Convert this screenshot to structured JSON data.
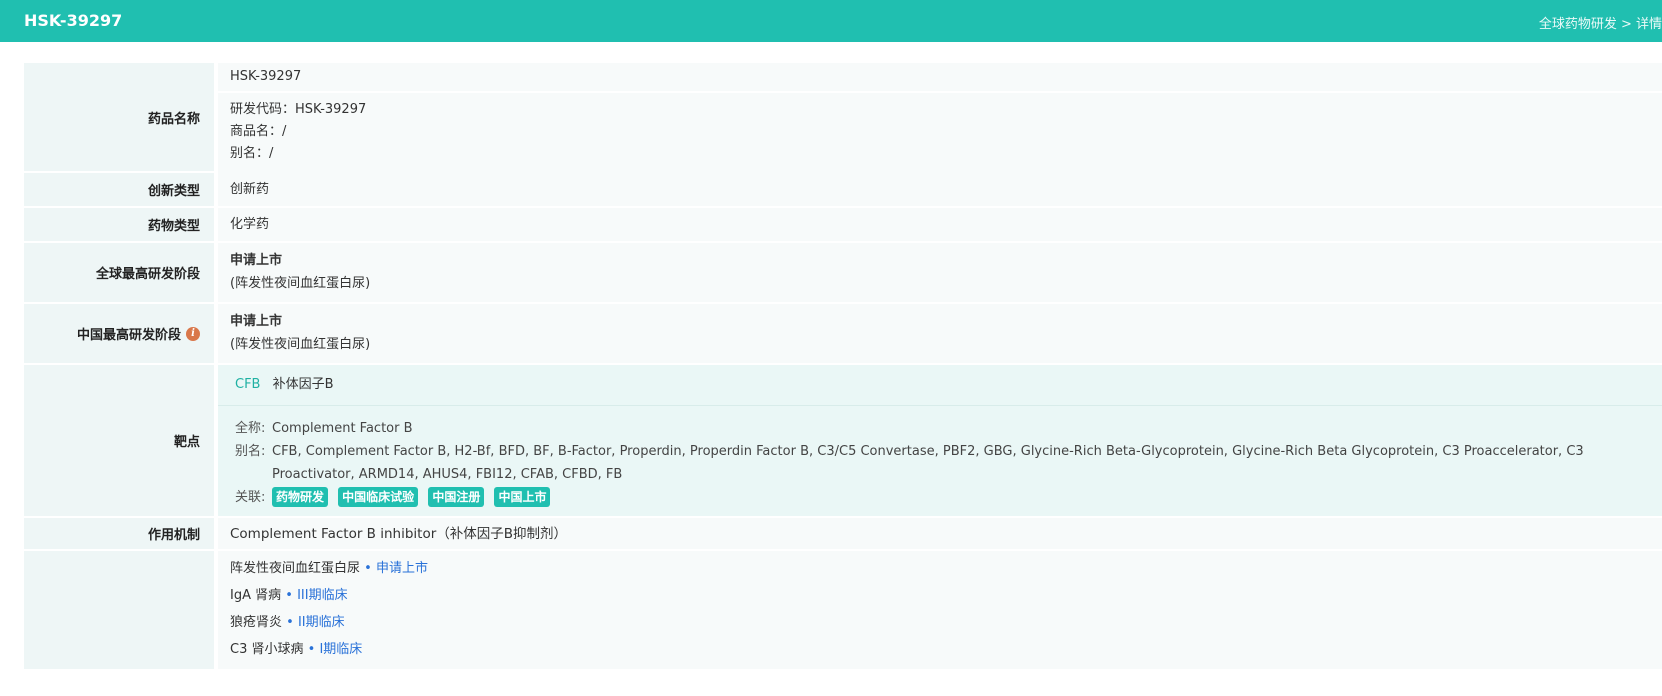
{
  "header": {
    "title": "HSK-39297",
    "breadcrumb": "全球药物研发 > 详情"
  },
  "drug_name": {
    "label": "药品名称",
    "name": "HSK-39297",
    "code": "研发代码：HSK-39297",
    "trade_name": "商品名：/",
    "alias": "别名：/"
  },
  "innovation": {
    "label": "创新类型",
    "value": "创新药"
  },
  "drug_type": {
    "label": "药物类型",
    "value": "化学药"
  },
  "global_stage": {
    "label": "全球最高研发阶段",
    "stage": "申请上市",
    "indication": "(阵发性夜间血红蛋白尿)"
  },
  "china_stage": {
    "label": "中国最高研发阶段",
    "icon": "info-icon",
    "stage": "申请上市",
    "indication": "(阵发性夜间血红蛋白尿)"
  },
  "target": {
    "label": "靶点",
    "code": "CFB",
    "name": "补体因子B",
    "fullname_key": "全称:",
    "fullname": "Complement Factor B",
    "alias_key": "别名:",
    "alias": "CFB, Complement Factor B, H2-Bf, BFD, BF, B-Factor, Properdin, Properdin Factor B, C3/C5 Convertase, PBF2, GBG, Glycine-Rich Beta-Glycoprotein, Glycine-Rich Beta Glycoprotein, C3 Proaccelerator, C3 Proactivator, ARMD14, AHUS4, FBI12, CFAB, CFBD, FB",
    "related_key": "关联:",
    "tags": [
      "药物研发",
      "中国临床试验",
      "中国注册",
      "中国上市"
    ]
  },
  "mechanism": {
    "label": "作用机制",
    "value": "Complement Factor B inhibitor（补体因子B抑制剂）"
  },
  "indications": [
    {
      "name": "阵发性夜间血红蛋白尿",
      "stage": "申请上市"
    },
    {
      "name": "IgA 肾病",
      "stage": "III期临床"
    },
    {
      "name": "狼疮肾炎",
      "stage": "II期临床"
    },
    {
      "name": "C3 肾小球病",
      "stage": "I期临床"
    }
  ],
  "colors": {
    "accent": "#20bfb0",
    "link": "#2a72d8",
    "info": "#d9774a"
  }
}
